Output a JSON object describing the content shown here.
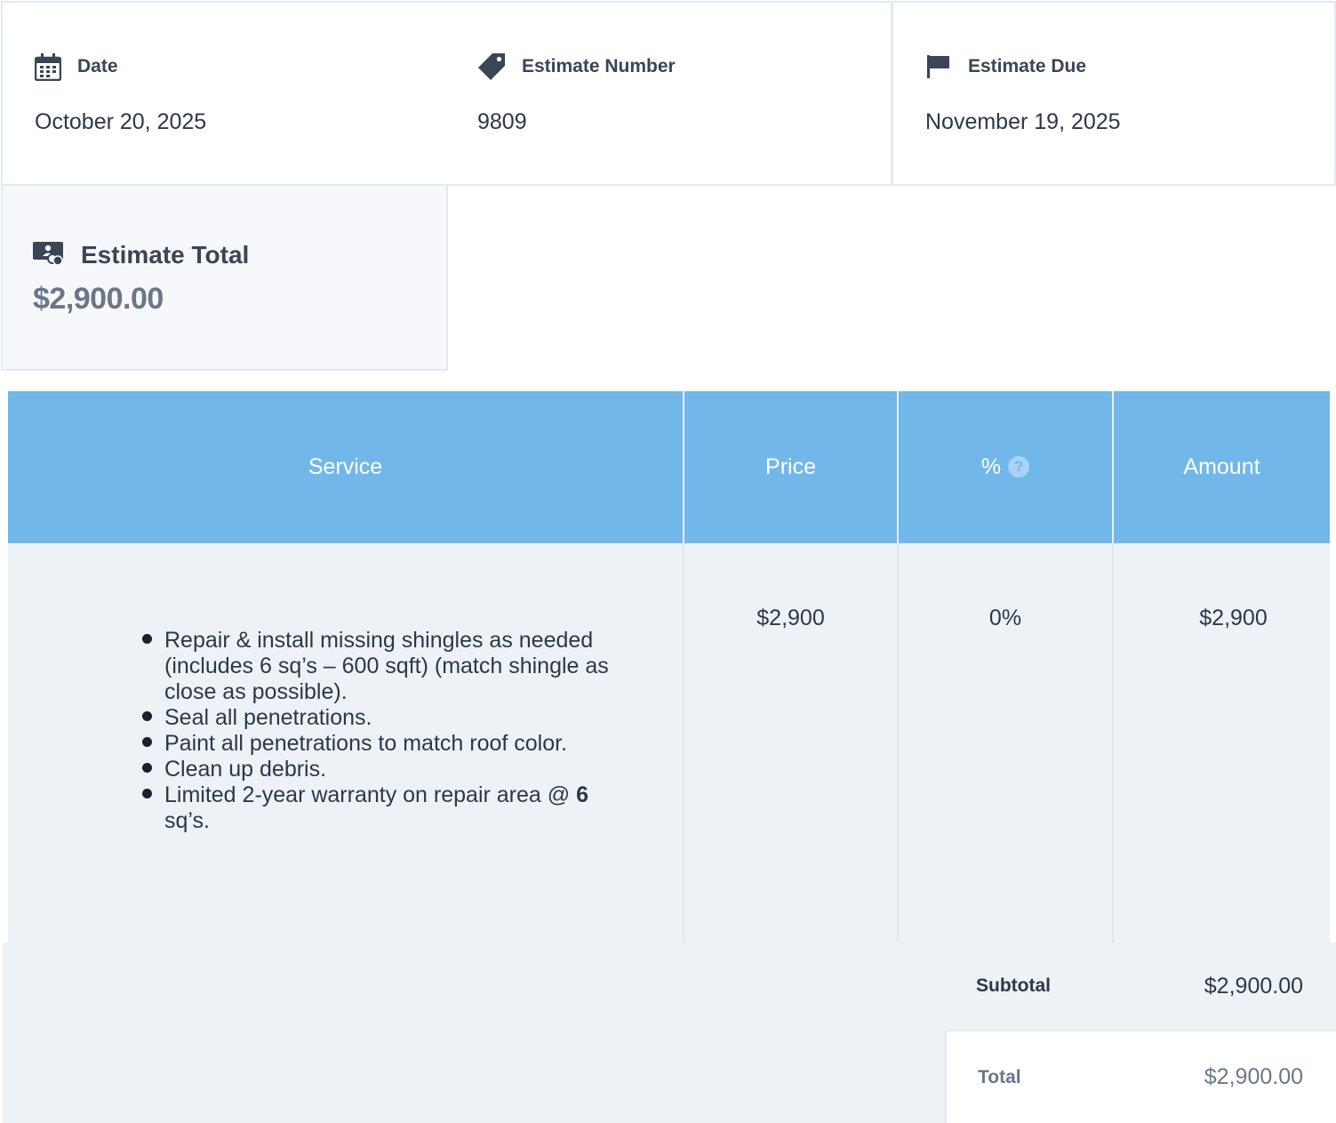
{
  "info": {
    "date": {
      "label": "Date",
      "value": "October 20, 2025",
      "icon": "calendar-icon"
    },
    "number": {
      "label": "Estimate Number",
      "value": "9809",
      "icon": "tag-icon"
    },
    "due": {
      "label": "Estimate Due",
      "value": "November 19, 2025",
      "icon": "flag-icon"
    }
  },
  "total_card": {
    "label": "Estimate Total",
    "value": "$2,900.00",
    "icon": "money-icon"
  },
  "table": {
    "headers": {
      "service": "Service",
      "price": "Price",
      "percent": "%",
      "amount": "Amount"
    },
    "help_glyph": "?",
    "row": {
      "items": [
        "Repair & install missing shingles as needed (includes 6 sq’s – 600 sqft) (match shingle as close as possible).",
        "Seal all penetrations.",
        "Paint all penetrations to match roof color.",
        "Clean up debris."
      ],
      "warranty_text": "Limited 2-year warranty on repair area @",
      "warranty_bold": "6",
      "warranty_tail": "sq’s.",
      "price": "$2,900",
      "percent": "0%",
      "amount": "$2,900"
    }
  },
  "summary": {
    "subtotal_label": "Subtotal",
    "subtotal_value": "$2,900.00",
    "total_label": "Total",
    "total_value": "$2,900.00"
  },
  "colors": {
    "header_bg": "#71b7ea",
    "row_bg": "#edf2f7",
    "text": "#2d3748",
    "muted": "#6b7788"
  }
}
